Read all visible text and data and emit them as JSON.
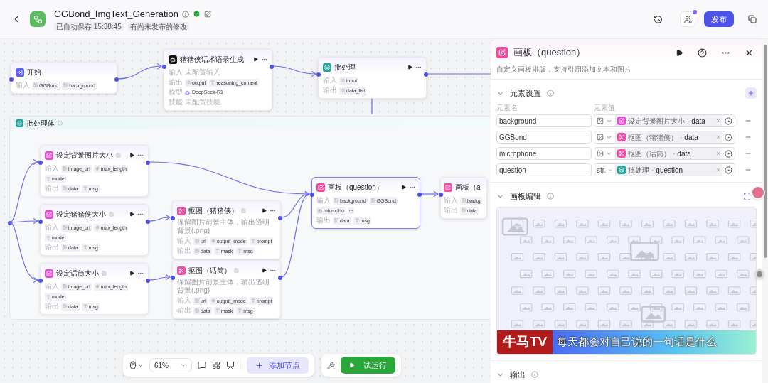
{
  "header": {
    "title": "GGBond_ImgText_Generation",
    "verified": true,
    "tags": [
      "已自动保存 15:38:45",
      "有尚未发布的修改"
    ],
    "has_notification": true,
    "publish": "发布"
  },
  "canvas": {
    "group": {
      "title": "批处理体"
    },
    "nodes": [
      {
        "kind": "start",
        "title": "开始",
        "selected": false,
        "actions": false,
        "note_icon": false,
        "rows": [
          {
            "label": "输入",
            "chips": [
              {
                "kind": "image",
                "text": "GGBond"
              },
              {
                "kind": "image",
                "text": "background"
              }
            ]
          }
        ]
      },
      {
        "kind": "llm",
        "title": "猪猪侠话术语录生成",
        "selected": false,
        "actions": true,
        "note_icon": false,
        "rows": [
          {
            "label": "输入",
            "note": "未配置输入"
          },
          {
            "label": "输出",
            "chips": [
              {
                "kind": "list",
                "text": "output"
              },
              {
                "kind": "string",
                "text": "reasoning_content"
              }
            ]
          },
          {
            "label": "模型",
            "model": "DeepSeek-R1"
          },
          {
            "label": "技能",
            "note": "未配置技能"
          }
        ]
      },
      {
        "kind": "batch",
        "title": "批处理",
        "selected": false,
        "actions": true,
        "note_icon": false,
        "rows": [
          {
            "label": "输入",
            "chips": [
              {
                "kind": "list",
                "text": "input"
              }
            ]
          },
          {
            "label": "输出",
            "chips": [
              {
                "kind": "list",
                "text": "data_list"
              }
            ]
          }
        ]
      },
      {
        "kind": "resize",
        "title": "设定背景图片大小",
        "selected": false,
        "actions": true,
        "note_icon": true,
        "rows": [
          {
            "label": "输入",
            "chips": [
              {
                "kind": "image",
                "text": "image_url"
              },
              {
                "kind": "number",
                "text": "max_length"
              },
              {
                "kind": "string",
                "text": "mode"
              }
            ]
          },
          {
            "label": "输出",
            "chips": [
              {
                "kind": "image",
                "text": "data"
              },
              {
                "kind": "string",
                "text": "msg"
              }
            ]
          }
        ]
      },
      {
        "kind": "resize",
        "title": "设定猪猪侠大小",
        "selected": false,
        "actions": true,
        "note_icon": true,
        "rows": [
          {
            "label": "输入",
            "chips": [
              {
                "kind": "image",
                "text": "image_url"
              },
              {
                "kind": "number",
                "text": "max_length"
              },
              {
                "kind": "string",
                "text": "mode"
              }
            ]
          },
          {
            "label": "输出",
            "chips": [
              {
                "kind": "image",
                "text": "data"
              },
              {
                "kind": "string",
                "text": "msg"
              }
            ]
          }
        ]
      },
      {
        "kind": "resize",
        "title": "设定话筒大小",
        "selected": false,
        "actions": true,
        "note_icon": true,
        "rows": [
          {
            "label": "输入",
            "chips": [
              {
                "kind": "image",
                "text": "image_url"
              },
              {
                "kind": "number",
                "text": "max_length"
              },
              {
                "kind": "string",
                "text": "mode"
              }
            ]
          },
          {
            "label": "输出",
            "chips": [
              {
                "kind": "image",
                "text": "data"
              },
              {
                "kind": "string",
                "text": "msg"
              }
            ]
          }
        ]
      },
      {
        "kind": "cutout",
        "title": "抠图（猪猪侠）",
        "selected": false,
        "actions": true,
        "note_icon": true,
        "description": "保留图片前景主体，输出透明背景(.png)",
        "rows": [
          {
            "label": "输入",
            "chips": [
              {
                "kind": "image",
                "text": "url"
              },
              {
                "kind": "number",
                "text": "output_mode"
              },
              {
                "kind": "string",
                "text": "prompt"
              }
            ]
          },
          {
            "label": "输出",
            "chips": [
              {
                "kind": "image",
                "text": "data"
              },
              {
                "kind": "string",
                "text": "mask"
              },
              {
                "kind": "string",
                "text": "msg"
              }
            ]
          }
        ]
      },
      {
        "kind": "cutout",
        "title": "抠图（话筒）",
        "selected": false,
        "actions": true,
        "note_icon": true,
        "description": "保留图片前景主体，输出透明背景(.png)",
        "rows": [
          {
            "label": "输入",
            "chips": [
              {
                "kind": "image",
                "text": "url"
              },
              {
                "kind": "number",
                "text": "output_mode"
              },
              {
                "kind": "string",
                "text": "prompt"
              }
            ]
          },
          {
            "label": "输出",
            "chips": [
              {
                "kind": "image",
                "text": "data"
              },
              {
                "kind": "string",
                "text": "mask"
              },
              {
                "kind": "string",
                "text": "msg"
              }
            ]
          }
        ]
      },
      {
        "kind": "canvas",
        "title": "画板（question）",
        "selected": true,
        "actions": true,
        "note_icon": false,
        "rows": [
          {
            "label": "输入",
            "overflow": true,
            "chips": [
              {
                "kind": "image",
                "text": "background"
              },
              {
                "kind": "image",
                "text": "GGBond"
              },
              {
                "kind": "image",
                "text": "micropho"
              }
            ]
          },
          {
            "label": "输出",
            "chips": [
              {
                "kind": "image",
                "text": "data"
              },
              {
                "kind": "string",
                "text": "msg"
              }
            ]
          }
        ]
      },
      {
        "kind": "canvas",
        "title": "画板（a",
        "selected": false,
        "actions": false,
        "note_icon": false,
        "rows": [
          {
            "label": "输入",
            "chips": [
              {
                "kind": "image",
                "text": "backg"
              }
            ]
          },
          {
            "label": "输出",
            "chips": [
              {
                "kind": "image",
                "text": "data"
              }
            ]
          }
        ]
      }
    ]
  },
  "toolbar": {
    "zoom": "61%",
    "add_node": "添加节点",
    "test_run": "试运行"
  },
  "panel": {
    "kind": "canvas",
    "title": "画板（question）",
    "description": "自定义画板排版，支持引用添加文本和图片",
    "elements": {
      "title": "元素设置",
      "expanded": true,
      "name_header": "元素名",
      "value_header": "元素值",
      "rows": [
        {
          "name": "background",
          "kind": "image",
          "source": {
            "kind": "resize",
            "node": "设定背景图片大小",
            "separator": "·",
            "field": "data"
          }
        },
        {
          "name": "GGBond",
          "kind": "image",
          "source": {
            "kind": "cutout",
            "node": "抠图（猪猪侠）",
            "separator": "·",
            "field": "data"
          }
        },
        {
          "name": "microphone",
          "kind": "image",
          "source": {
            "kind": "cutout",
            "node": "抠图（话筒）",
            "separator": "·",
            "field": "data"
          }
        },
        {
          "name": "question",
          "kind": "string",
          "type_label": "str.",
          "source": {
            "kind": "batch",
            "node": "批处理",
            "separator": "·",
            "field": "question"
          }
        }
      ]
    },
    "editor": {
      "title": "画板编辑",
      "expanded": true,
      "banner": {
        "brand": "牛马TV",
        "caption": "每天都会对自己说的一句话是什么"
      }
    },
    "output": {
      "title": "输出",
      "expanded": true
    }
  }
}
